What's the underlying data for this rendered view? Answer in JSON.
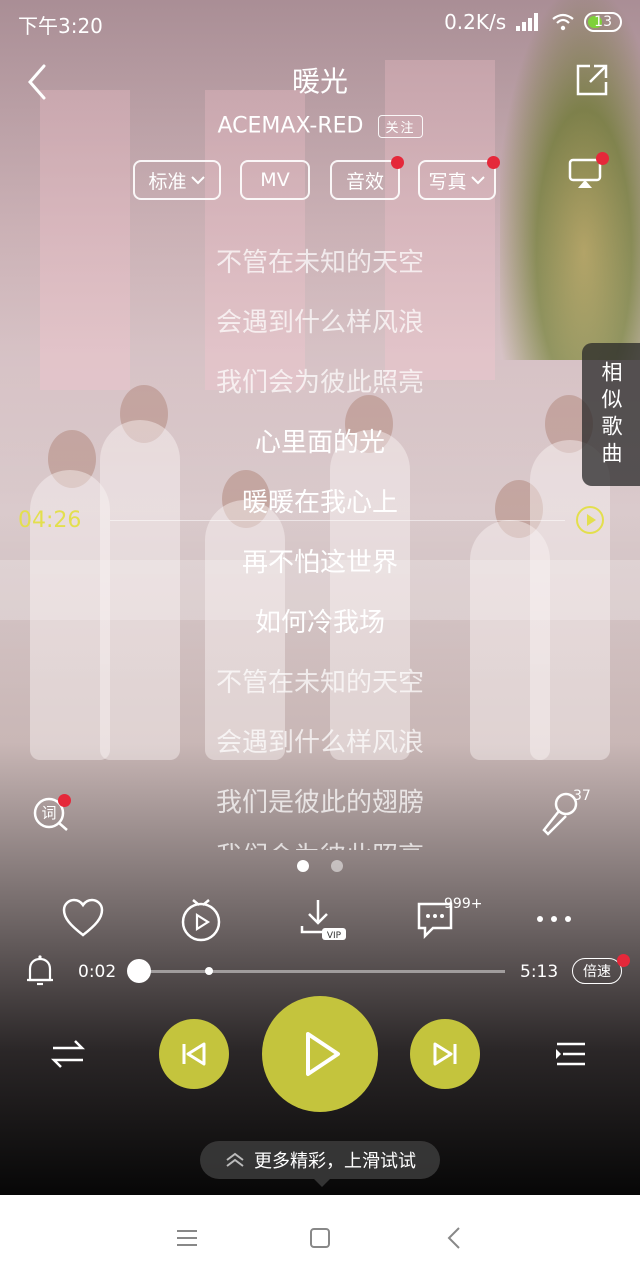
{
  "status_bar": {
    "time": "下午3:20",
    "net_speed": "0.2K/s",
    "battery": "13"
  },
  "header": {
    "title": "暖光",
    "artist": "ACEMAX-RED",
    "follow_label": "关注"
  },
  "options": [
    {
      "label": "标准",
      "has_dropdown": true,
      "has_dot": false
    },
    {
      "label": "MV",
      "has_dropdown": false,
      "has_dot": false
    },
    {
      "label": "音效",
      "has_dropdown": false,
      "has_dot": true
    },
    {
      "label": "写真",
      "has_dropdown": true,
      "has_dot": true
    }
  ],
  "lyrics": [
    {
      "text": "不管在未知的天空",
      "active": false
    },
    {
      "text": "会遇到什么样风浪",
      "active": false
    },
    {
      "text": "我们会为彼此照亮",
      "active": false
    },
    {
      "text": "心里面的光",
      "active": true
    },
    {
      "text": "暖暖在我心上",
      "active": true
    },
    {
      "text": "再不怕这世界",
      "active": true
    },
    {
      "text": "如何冷我场",
      "active": true
    },
    {
      "text": "不管在未知的天空",
      "active": false
    },
    {
      "text": "会遇到什么样风浪",
      "active": false
    },
    {
      "text": "我们是彼此的翅膀",
      "active": false
    },
    {
      "text": "我们会为彼此照亮",
      "active": false
    }
  ],
  "lyric_time_marker": "04:26",
  "similar_songs_label": "相似歌曲",
  "lyric_search_icon_label": "词",
  "mic_count": "37",
  "comment_count": "999+",
  "download_badge": "VIP",
  "progress": {
    "current": "0:02",
    "total": "5:13",
    "played_fraction": 0.01,
    "marker_fraction": 0.2
  },
  "speed_label": "倍速",
  "swipe_hint": "更多精彩，上滑试试",
  "colors": {
    "accent": "#c4c43d",
    "time_marker": "#e3df4d",
    "red_dot": "#e5283a"
  }
}
